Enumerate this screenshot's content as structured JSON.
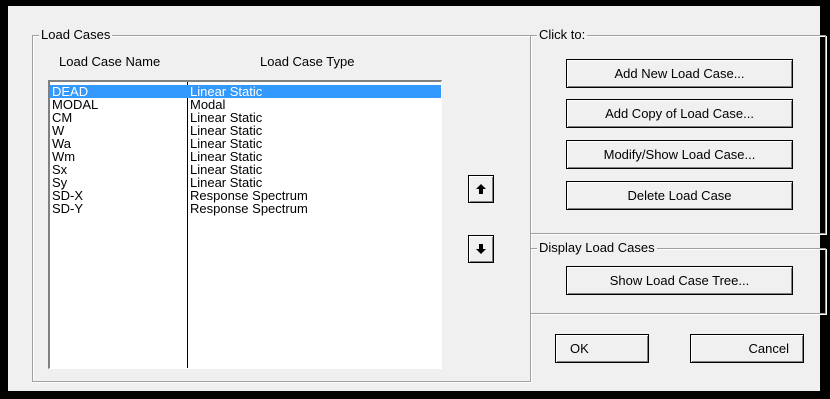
{
  "load_cases": {
    "group_title": "Load Cases",
    "col_name": "Load Case Name",
    "col_type": "Load Case Type",
    "rows": [
      {
        "name": "DEAD",
        "type": "Linear Static"
      },
      {
        "name": "MODAL",
        "type": "Modal"
      },
      {
        "name": "CM",
        "type": "Linear Static"
      },
      {
        "name": "W",
        "type": "Linear Static"
      },
      {
        "name": "Wa",
        "type": "Linear Static"
      },
      {
        "name": "Wm",
        "type": "Linear Static"
      },
      {
        "name": "Sx",
        "type": "Linear Static"
      },
      {
        "name": "Sy",
        "type": "Linear Static"
      },
      {
        "name": "SD-X",
        "type": "Response Spectrum"
      },
      {
        "name": "SD-Y",
        "type": "Response Spectrum"
      }
    ],
    "selected_index": 0
  },
  "reorder": {
    "up_icon": "arrow-up-icon",
    "down_icon": "arrow-down-icon"
  },
  "click_to": {
    "group_title": "Click to:",
    "add_new": "Add New Load Case...",
    "add_copy": "Add Copy of Load Case...",
    "modify_show": "Modify/Show Load Case...",
    "delete": "Delete Load Case"
  },
  "display": {
    "group_title": "Display Load Cases",
    "show_tree": "Show Load Case Tree..."
  },
  "footer": {
    "ok": "OK",
    "cancel": "Cancel"
  },
  "colors": {
    "selection": "#3399ff",
    "dialog_bg": "#f0f0f0"
  }
}
